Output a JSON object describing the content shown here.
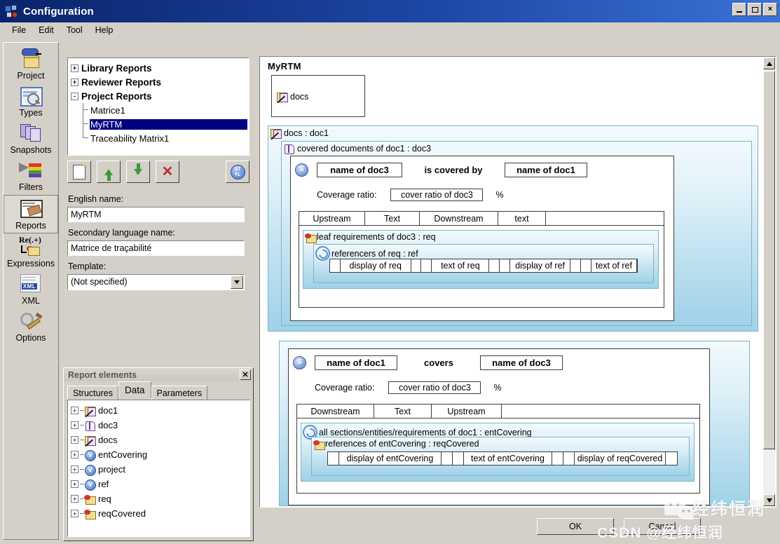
{
  "window": {
    "title": "Configuration",
    "icon": "config-icon",
    "controls": {
      "minimize": "_",
      "maximize": "□",
      "close": "×"
    }
  },
  "menu": {
    "items": [
      "File",
      "Edit",
      "Tool",
      "Help"
    ]
  },
  "rail": {
    "items": [
      {
        "label": "Project",
        "icon": "project-icon",
        "selected": false
      },
      {
        "label": "Types",
        "icon": "types-icon",
        "selected": false
      },
      {
        "label": "Snapshots",
        "icon": "snapshots-icon",
        "selected": false
      },
      {
        "label": "Filters",
        "icon": "filters-icon",
        "selected": false
      },
      {
        "label": "Reports",
        "icon": "reports-icon",
        "selected": true
      },
      {
        "label": "Expressions",
        "icon": "expressions-icon",
        "selected": false
      },
      {
        "label": "XML",
        "icon": "xml-icon",
        "selected": false
      },
      {
        "label": "Options",
        "icon": "options-icon",
        "selected": false
      }
    ],
    "expressions_glyph": "Re(.+)",
    "xml_glyph": "XML"
  },
  "report_tree": {
    "nodes": [
      {
        "label": "Library Reports",
        "expander": "+",
        "root": true,
        "selected": false
      },
      {
        "label": "Reviewer Reports",
        "expander": "+",
        "root": true,
        "selected": false
      },
      {
        "label": "Project Reports",
        "expander": "-",
        "root": true,
        "selected": false
      },
      {
        "label": "Matrice1",
        "root": false,
        "selected": false,
        "last": false
      },
      {
        "label": "MyRTM",
        "root": false,
        "selected": true,
        "last": false
      },
      {
        "label": "Traceability Matrix1",
        "root": false,
        "selected": false,
        "last": true
      }
    ]
  },
  "toolbar": {
    "buttons": [
      {
        "name": "new-report-button",
        "icon": "new-document-icon"
      },
      {
        "name": "move-up-button",
        "icon": "arrow-up-icon"
      },
      {
        "name": "move-down-button",
        "icon": "arrow-down-icon"
      },
      {
        "name": "delete-button",
        "icon": "delete-x-icon",
        "glyph": "✕"
      },
      {
        "name": "style-button",
        "icon": "style-globe-icon",
        "glyph": "ST YL"
      }
    ]
  },
  "form": {
    "english_name_label": "English name:",
    "english_name_value": "MyRTM",
    "secondary_label": "Secondary language name:",
    "secondary_value": "Matrice de traçabilité",
    "template_label": "Template:",
    "template_value": "(Not specified)"
  },
  "report_elements": {
    "title": "Report elements",
    "close_glyph": "✕",
    "tabs": [
      {
        "label": "Structures",
        "active": false
      },
      {
        "label": "Data",
        "active": true
      },
      {
        "label": "Parameters",
        "active": false
      }
    ],
    "tree": [
      {
        "label": "doc1",
        "expander": "+",
        "icon": "document-yellow-icon"
      },
      {
        "label": "doc3",
        "expander": "+",
        "icon": "document-purple-icon"
      },
      {
        "label": "docs",
        "expander": "+",
        "icon": "document-yellow-icon"
      },
      {
        "label": "entCovering",
        "expander": "+",
        "icon": "variable-ball-icon"
      },
      {
        "label": "project",
        "expander": "+",
        "icon": "variable-ball-icon"
      },
      {
        "label": "ref",
        "expander": "+",
        "icon": "variable-ball-icon"
      },
      {
        "label": "req",
        "expander": "+",
        "icon": "requirement-icon"
      },
      {
        "label": "reqCovered",
        "expander": "+",
        "icon": "requirement-icon"
      }
    ]
  },
  "canvas": {
    "title": "MyRTM",
    "top_box": {
      "label": "docs",
      "icon": "document-yellow-icon"
    },
    "section1": {
      "label": "docs : doc1",
      "icon": "document-yellow-icon",
      "inner_label": "covered documents of doc1 : doc3",
      "inner_icon": "document-purple-icon",
      "header": {
        "badge": "S",
        "left_chip": "name of doc3",
        "middle_text": "is covered by",
        "right_chip": "name of doc1"
      },
      "coverage_label": "Coverage ratio:",
      "coverage_field": "cover ratio of doc3",
      "coverage_unit": "%",
      "table_headers": [
        "Upstream",
        "Text",
        "Downstream",
        "text"
      ],
      "leaf_label": "leaf requirements of doc3 : req",
      "leaf_icon": "requirement-icon",
      "ref_label": "referencers of req : ref",
      "ref_icon": "cycle-icon",
      "row_cells": [
        "display of req",
        "text of req",
        "display of ref",
        "text of ref"
      ]
    },
    "section2": {
      "header": {
        "badge": "S",
        "left_chip": "name of doc1",
        "middle_text": "covers",
        "right_chip": "name of doc3"
      },
      "coverage_label": "Coverage ratio:",
      "coverage_field": "cover ratio of doc3",
      "coverage_unit": "%",
      "table_headers": [
        "Downstream",
        "Text",
        "Upstream"
      ],
      "leaf_label": "all sections/entities/requirements of doc1 : entCovering",
      "leaf_icon": "cycle-icon",
      "ref_label": "references of entCovering : reqCovered",
      "ref_icon": "requirement-icon",
      "row_cells": [
        "display of entCovering",
        "text of entCovering",
        "display of reqCovered"
      ]
    }
  },
  "dialog": {
    "ok_label": "OK",
    "cancel_label": "Cancel"
  },
  "watermark": {
    "brand": "经纬恒润",
    "csdn": "CSDN  @经纬恒润"
  },
  "colors": {
    "titlebar_start": "#0a246a",
    "titlebar_end": "#3a72d6",
    "selection": "#000080",
    "window_face": "#d4d0c8",
    "section_blue": "#9fd2e8"
  }
}
